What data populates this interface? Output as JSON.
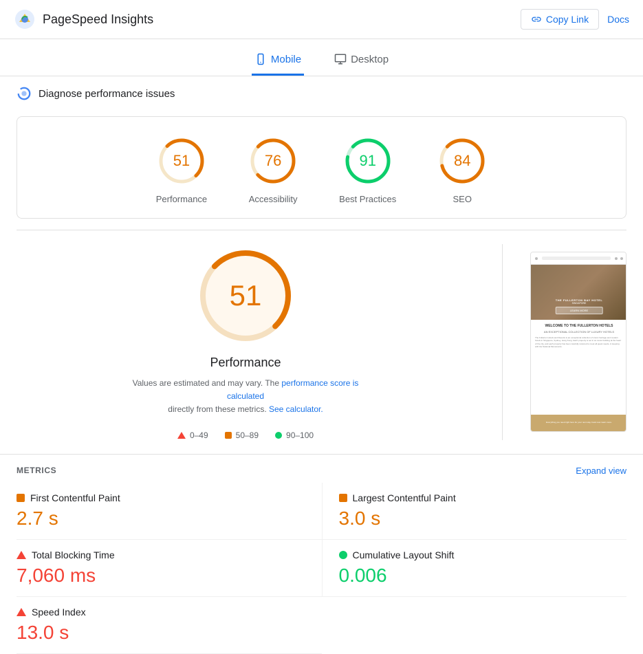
{
  "header": {
    "title": "PageSpeed Insights",
    "copy_button_label": "Copy Link",
    "docs_label": "Docs"
  },
  "tabs": [
    {
      "id": "mobile",
      "label": "Mobile",
      "active": true
    },
    {
      "id": "desktop",
      "label": "Desktop",
      "active": false
    }
  ],
  "diagnose": {
    "text": "Diagnose performance issues"
  },
  "scores": [
    {
      "id": "performance",
      "label": "Performance",
      "value": 51,
      "color": "#e37400",
      "bg": "#fff8e6",
      "stroke": "#e37400",
      "radius": 30
    },
    {
      "id": "accessibility",
      "label": "Accessibility",
      "value": 76,
      "color": "#e37400",
      "bg": "#fff8e6",
      "stroke": "#e37400",
      "radius": 30
    },
    {
      "id": "best-practices",
      "label": "Best Practices",
      "value": 91,
      "color": "#0cce6b",
      "bg": "#e6faf0",
      "stroke": "#0cce6b",
      "radius": 30
    },
    {
      "id": "seo",
      "label": "SEO",
      "value": 84,
      "color": "#e37400",
      "bg": "#fff8e6",
      "stroke": "#e37400",
      "radius": 30
    }
  ],
  "performance_detail": {
    "score": 51,
    "title": "Performance",
    "description1": "Values are estimated and may vary. The",
    "link1_text": "performance score is calculated",
    "description2": "directly from these metrics.",
    "link2_text": "See calculator.",
    "legend": [
      {
        "type": "triangle",
        "range": "0–49"
      },
      {
        "type": "square",
        "range": "50–89"
      },
      {
        "type": "circle",
        "range": "90–100"
      }
    ]
  },
  "metrics": {
    "label": "METRICS",
    "expand_label": "Expand view",
    "items": [
      {
        "id": "fcp",
        "name": "First Contentful Paint",
        "value": "2.7 s",
        "indicator": "square",
        "color": "orange"
      },
      {
        "id": "lcp",
        "name": "Largest Contentful Paint",
        "value": "3.0 s",
        "indicator": "square",
        "color": "orange"
      },
      {
        "id": "tbt",
        "name": "Total Blocking Time",
        "value": "7,060 ms",
        "indicator": "triangle",
        "color": "red"
      },
      {
        "id": "cls",
        "name": "Cumulative Layout Shift",
        "value": "0.006",
        "indicator": "circle",
        "color": "green"
      },
      {
        "id": "si",
        "name": "Speed Index",
        "value": "13.0 s",
        "indicator": "triangle",
        "color": "red"
      }
    ]
  }
}
